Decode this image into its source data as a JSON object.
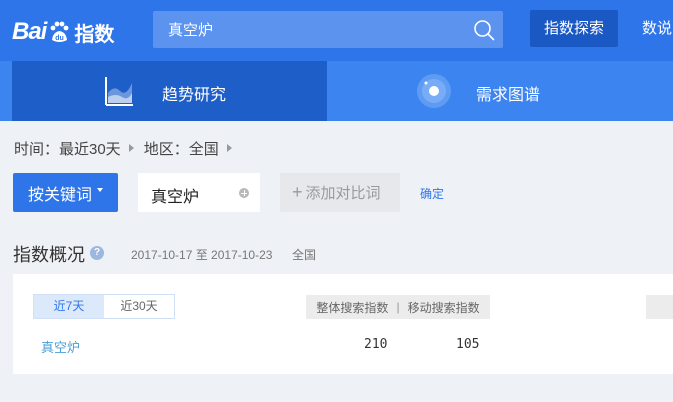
{
  "header": {
    "logo": {
      "latin": "Bai",
      "paw_text": "du",
      "chinese": "指数"
    },
    "search": {
      "value": "真空炉",
      "icon": "search-icon"
    },
    "nav_button": "指数探索",
    "nav_more": "数说"
  },
  "subnav": {
    "tabs": [
      {
        "label": "趋势研究",
        "icon": "trend-chart-icon",
        "active": true
      },
      {
        "label": "需求图谱",
        "icon": "demand-graph-icon",
        "active": false
      }
    ]
  },
  "filters": {
    "time": "时间：最近30天",
    "region": "地区：全国"
  },
  "keywords": {
    "mode_button": "按关键词",
    "chip": "真空炉",
    "add_compare": "添加对比词",
    "confirm": "确定"
  },
  "overview": {
    "title": "指数概况",
    "date_range": "2017-10-17 至 2017-10-23",
    "region": "全国",
    "period_tabs": [
      {
        "label": "近7天",
        "active": true
      },
      {
        "label": "近30天",
        "active": false
      }
    ],
    "columns": {
      "overall": "整体搜索指数",
      "separator": "|",
      "mobile": "移动搜索指数"
    },
    "rows": [
      {
        "keyword": "真空炉",
        "overall": "210",
        "mobile": "105"
      }
    ]
  },
  "colors": {
    "header_bg": "#2f75ea",
    "subnav_bg": "#3c85f0",
    "subnav_active": "#1e5ec9",
    "accent": "#2f75ea",
    "page_bg": "#eef1f5"
  }
}
